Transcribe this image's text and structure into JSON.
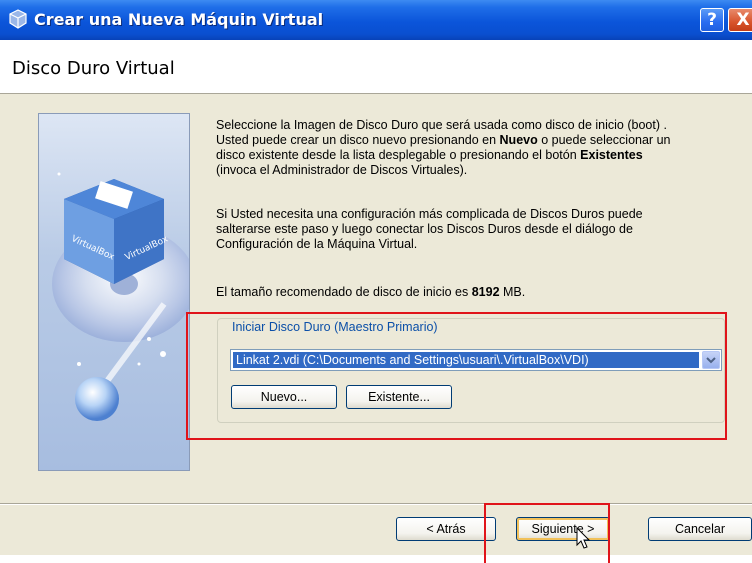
{
  "window": {
    "title": "Crear una Nueva Máquin Virtual",
    "help_glyph": "?",
    "close_glyph": "X"
  },
  "header": {
    "title": "Disco Duro Virtual"
  },
  "side_image": {
    "box_labels": [
      "VirtualBox",
      "VirtualBox"
    ]
  },
  "body": {
    "paragraph1": {
      "line1": "Seleccione la Imagen de Disco Duro que será usada como disco de inicio (boot) .",
      "line2_pre": "Usted puede crear un disco nuevo presionando en ",
      "line2_bold": "Nuevo",
      "line2_post": " o puede seleccionar un",
      "line3_pre": "disco existente desde la lista desplegable o presionando el botón ",
      "line3_bold": "Existentes",
      "line4": "(invoca el Administrador de Discos Virtuales)."
    },
    "paragraph2": {
      "line1": "Si Usted necesita una configuración más complicada de Discos Duros puede",
      "line2": "salterarse este paso y luego conectar los Discos Duros desde el diálogo de",
      "line3": "Configuración de la Máquina Virtual."
    },
    "paragraph3": {
      "pre": "El tamaño recomendado de disco de inicio es ",
      "size": "8192",
      "unit": " MB."
    }
  },
  "disk_group": {
    "legend": "Iniciar Disco Duro (Maestro Primario)",
    "selected_disk": "Linkat 2.vdi (C:\\Documents and Settings\\usuari\\.VirtualBox\\VDI)",
    "nuevo_label": "Nuevo...",
    "existente_label": "Existente..."
  },
  "footer": {
    "back_label": "< Atrás",
    "next_label": "Siguiente >",
    "cancel_label": "Cancelar"
  },
  "colors": {
    "titlebar": "#0b55da",
    "selection": "#316ac5",
    "highlight": "#e0141a",
    "dialog_bg": "#ece9d8"
  }
}
